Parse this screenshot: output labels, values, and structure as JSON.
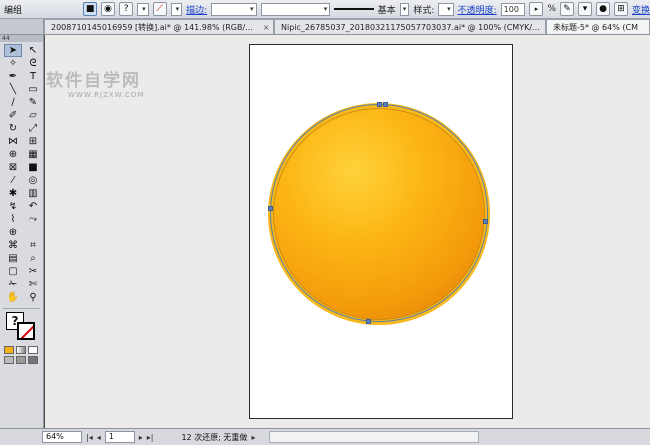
{
  "control_bar": {
    "mode": "编组",
    "stroke_label": "描边:",
    "brush_label": "基本",
    "style_label": "样式:",
    "opacity_label": "不透明度:",
    "opacity_value": "100",
    "opacity_unit": "%",
    "transform_label": "变换"
  },
  "tabs": [
    {
      "label": "20087101450169​59 [转换].ai* @ 141.98% (RGB/...",
      "close": "×"
    },
    {
      "label": "Nipic_26785037_20180321175057703037.ai* @ 100% (CMYK/...",
      "close": "×"
    },
    {
      "label": "未标题-5* @ 64% (CM"
    }
  ],
  "tools_header": "44",
  "tools": [
    "selection-icon",
    "direct-selection-icon",
    "magic-wand-icon",
    "lasso-icon",
    "pen-icon",
    "type-icon",
    "line-icon",
    "rectangle-icon",
    "paintbrush-icon",
    "pencil-icon",
    "blob-brush-icon",
    "eraser-icon",
    "rotate-icon",
    "scale-icon",
    "width-icon",
    "free-transform-icon",
    "shape-builder-icon",
    "perspective-icon",
    "mesh-icon",
    "gradient-icon",
    "eyedropper-icon",
    "blend-icon",
    "symbol-sprayer-icon",
    "graph-icon",
    "curvature-icon",
    "curvature-alt-icon",
    "pathfinder-icon",
    "join-icon",
    "crosshair-icon",
    "",
    "warp-icon",
    "envelope-icon",
    "column-icon",
    "slice-icon",
    "artboard-icon",
    "chart-icon",
    "knife-icon",
    "scissors-icon",
    "hand-icon",
    "zoom-icon"
  ],
  "tool_glyphs": {
    "selection-icon": "➤",
    "direct-selection-icon": "↖",
    "magic-wand-icon": "✧",
    "lasso-icon": "ᘓ",
    "pen-icon": "✒",
    "type-icon": "T",
    "line-icon": "╲",
    "rectangle-icon": "▭",
    "paintbrush-icon": "∕",
    "pencil-icon": "✎",
    "blob-brush-icon": "✐",
    "eraser-icon": "▱",
    "rotate-icon": "↻",
    "scale-icon": "⤢",
    "width-icon": "⋈",
    "free-transform-icon": "⊞",
    "shape-builder-icon": "⊕",
    "perspective-icon": "▦",
    "mesh-icon": "⊠",
    "gradient-icon": "■",
    "eyedropper-icon": "⁄",
    "blend-icon": "◎",
    "symbol-sprayer-icon": "✱",
    "graph-icon": "▥",
    "curvature-icon": "↯",
    "curvature-alt-icon": "↶",
    "pathfinder-icon": "⌇",
    "join-icon": "⤳",
    "crosshair-icon": "⊕",
    "warp-icon": "⌘",
    "envelope-icon": "⌗",
    "column-icon": "▤",
    "slice-icon": "⌕",
    "artboard-icon": "▢",
    "chart-icon": "✂",
    "knife-icon": "✁",
    "scissors-icon": "✄",
    "hand-icon": "✋",
    "zoom-icon": "⚲"
  },
  "fill_symbol": "?",
  "watermark": {
    "title": "软件自学网",
    "url": "WWW.RJZXW.COM"
  },
  "status": {
    "zoom": "64%",
    "page": "1",
    "message": "12 次还原; 无重做"
  },
  "colors": {
    "ball_light": "#ffd23b",
    "ball_mid": "#fcb614",
    "ball_dark": "#d66f04",
    "ball_stroke": "#f7b81c",
    "anchor": "#5c7fb8"
  }
}
